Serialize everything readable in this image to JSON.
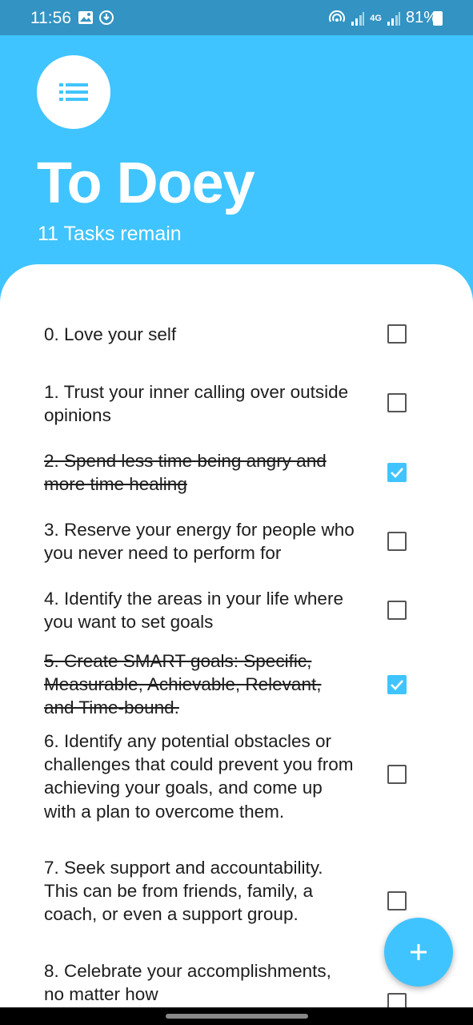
{
  "status_bar": {
    "time": "11:56",
    "network": "4G",
    "battery": "81%"
  },
  "header": {
    "menu_icon": "list-icon",
    "title": "To Doey",
    "subtitle": "11 Tasks remain"
  },
  "colors": {
    "accent": "#40c4ff",
    "status_bar": "#3393c2"
  },
  "tasks": [
    {
      "text": "0. Love your self",
      "checked": false
    },
    {
      "text": "1. Trust your inner calling over outside opinions",
      "checked": false
    },
    {
      "text": "2. Spend less time being angry and more time healing",
      "checked": true
    },
    {
      "text": "3. Reserve your energy for people who you never need to perform for",
      "checked": false
    },
    {
      "text": "4. Identify the areas in your life where you want to set goals",
      "checked": false
    },
    {
      "text": "5. Create SMART goals: Specific, Measurable, Achievable, Relevant, and Time-bound.",
      "checked": true
    },
    {
      "text": "6. Identify any potential obstacles or challenges that could prevent you from achieving your goals, and come up with a plan to overcome them.",
      "checked": false
    },
    {
      "text": "7. Seek support and accountability. This can be from friends, family, a coach, or even a support group.",
      "checked": false
    },
    {
      "text": "8. Celebrate your accomplishments, no matter how",
      "checked": false
    }
  ],
  "fab": {
    "icon": "plus-icon"
  }
}
